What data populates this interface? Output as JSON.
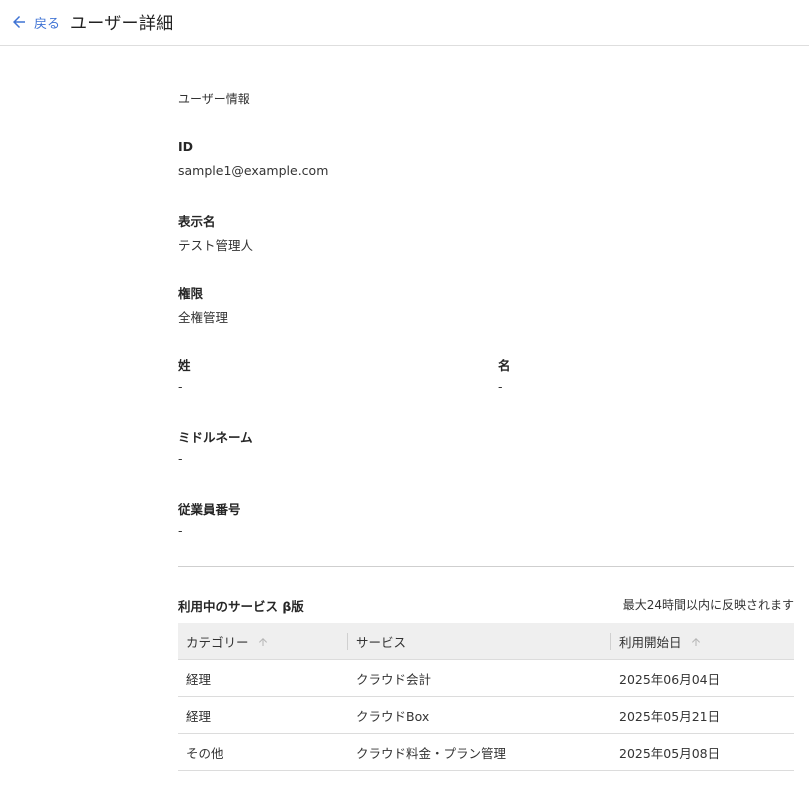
{
  "header": {
    "back_label": "戻る",
    "title": "ユーザー詳細"
  },
  "section": {
    "title": "ユーザー情報"
  },
  "fields": {
    "id": {
      "label": "ID",
      "value": "sample1@example.com"
    },
    "display_name": {
      "label": "表示名",
      "value": "テスト管理人"
    },
    "permission": {
      "label": "権限",
      "value": "全権管理"
    },
    "last_name": {
      "label": "姓",
      "value": "-"
    },
    "first_name": {
      "label": "名",
      "value": "-"
    },
    "middle_name": {
      "label": "ミドルネーム",
      "value": "-"
    },
    "employee_number": {
      "label": "従業員番号",
      "value": "-"
    }
  },
  "services": {
    "title": "利用中のサービス β版",
    "note": "最大24時間以内に反映されます",
    "columns": [
      "カテゴリー",
      "サービス",
      "利用開始日"
    ],
    "rows": [
      [
        "経理",
        "クラウド会計",
        "2025年06月04日"
      ],
      [
        "経理",
        "クラウドBox",
        "2025年05月21日"
      ],
      [
        "その他",
        "クラウド料金・プラン管理",
        "2025年05月08日"
      ]
    ]
  },
  "colors": {
    "accent": "#3f73d4",
    "header_bg": "#efefef",
    "divider": "#dcdcdc"
  },
  "icons": {
    "back": "arrow-left-icon",
    "sort": "arrow-up-icon"
  }
}
